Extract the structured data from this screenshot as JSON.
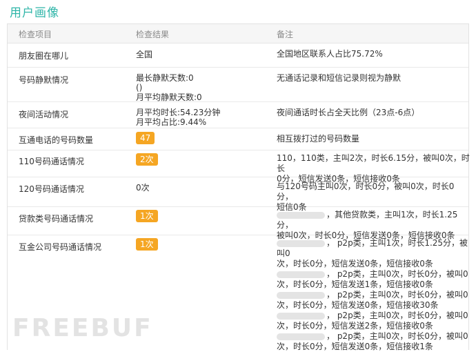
{
  "title": "用户画像",
  "table": {
    "headers": [
      "检查项目",
      "检查结果",
      "备注"
    ],
    "rows": [
      {
        "label": "朋友圈在哪儿",
        "values": [
          "全国"
        ],
        "note": [
          "全国地区联系人占比75.72%"
        ]
      },
      {
        "label": "号码静默情况",
        "values": [
          "最长静默天数:0",
          "()",
          "月平均静默天数:0"
        ],
        "note": [
          "无通话记录和短信记录则视为静默"
        ]
      },
      {
        "label": "夜间活动情况",
        "values": [
          "月平均时长:54.23分钟",
          "月平均占比:9.44%"
        ],
        "note": [
          "夜间通话时长占全天比例（23点-6点）"
        ]
      },
      {
        "label": "互通电话的号码数量",
        "badge": "47",
        "note": [
          "相互拨打过的号码数量"
        ]
      },
      {
        "label": "110号码通话情况",
        "badge": "2次",
        "note": [
          "110，110类，主叫2次，时长6.15分，被叫0次，时长",
          "0分，短信发送0条，短信接收0条"
        ]
      },
      {
        "label": "120号码通话情况",
        "values": [
          "0次"
        ],
        "note": [
          "与120号码主叫0次，时长0分，被叫0次，时长0分，",
          "短信0条"
        ]
      },
      {
        "label": "贷款类号码通话情况",
        "badge": "1次",
        "note": [
          "，其他贷款类，主叫1次，时长1.25分，",
          "被叫0次，时长0分，短信发送0条，短信接收0条"
        ]
      },
      {
        "label": "互金公司号码通话情况",
        "badge": "1次",
        "note": [
          "， p2p类，主叫1次，时长1.25分，被叫0",
          "次，时长0分，短信发送0条，短信接收0条",
          "， p2p类，主叫0次，时长0分，被叫0",
          "次，时长0分，短信发送1条，短信接收0条",
          "， p2p类，主叫0次，时长0分，被叫0",
          "次，时长0分，短信发送0条，短信接收30条",
          "， p2p类，主叫0次，时长0分，被叫0",
          "次，时长0分，短信发送2条，短信接收0条",
          "， p2p类，主叫0次，时长0分，被叫0",
          "次，时长0分，短信发送0条，短信接收1条"
        ]
      }
    ]
  },
  "watermark": "FREEBUF"
}
